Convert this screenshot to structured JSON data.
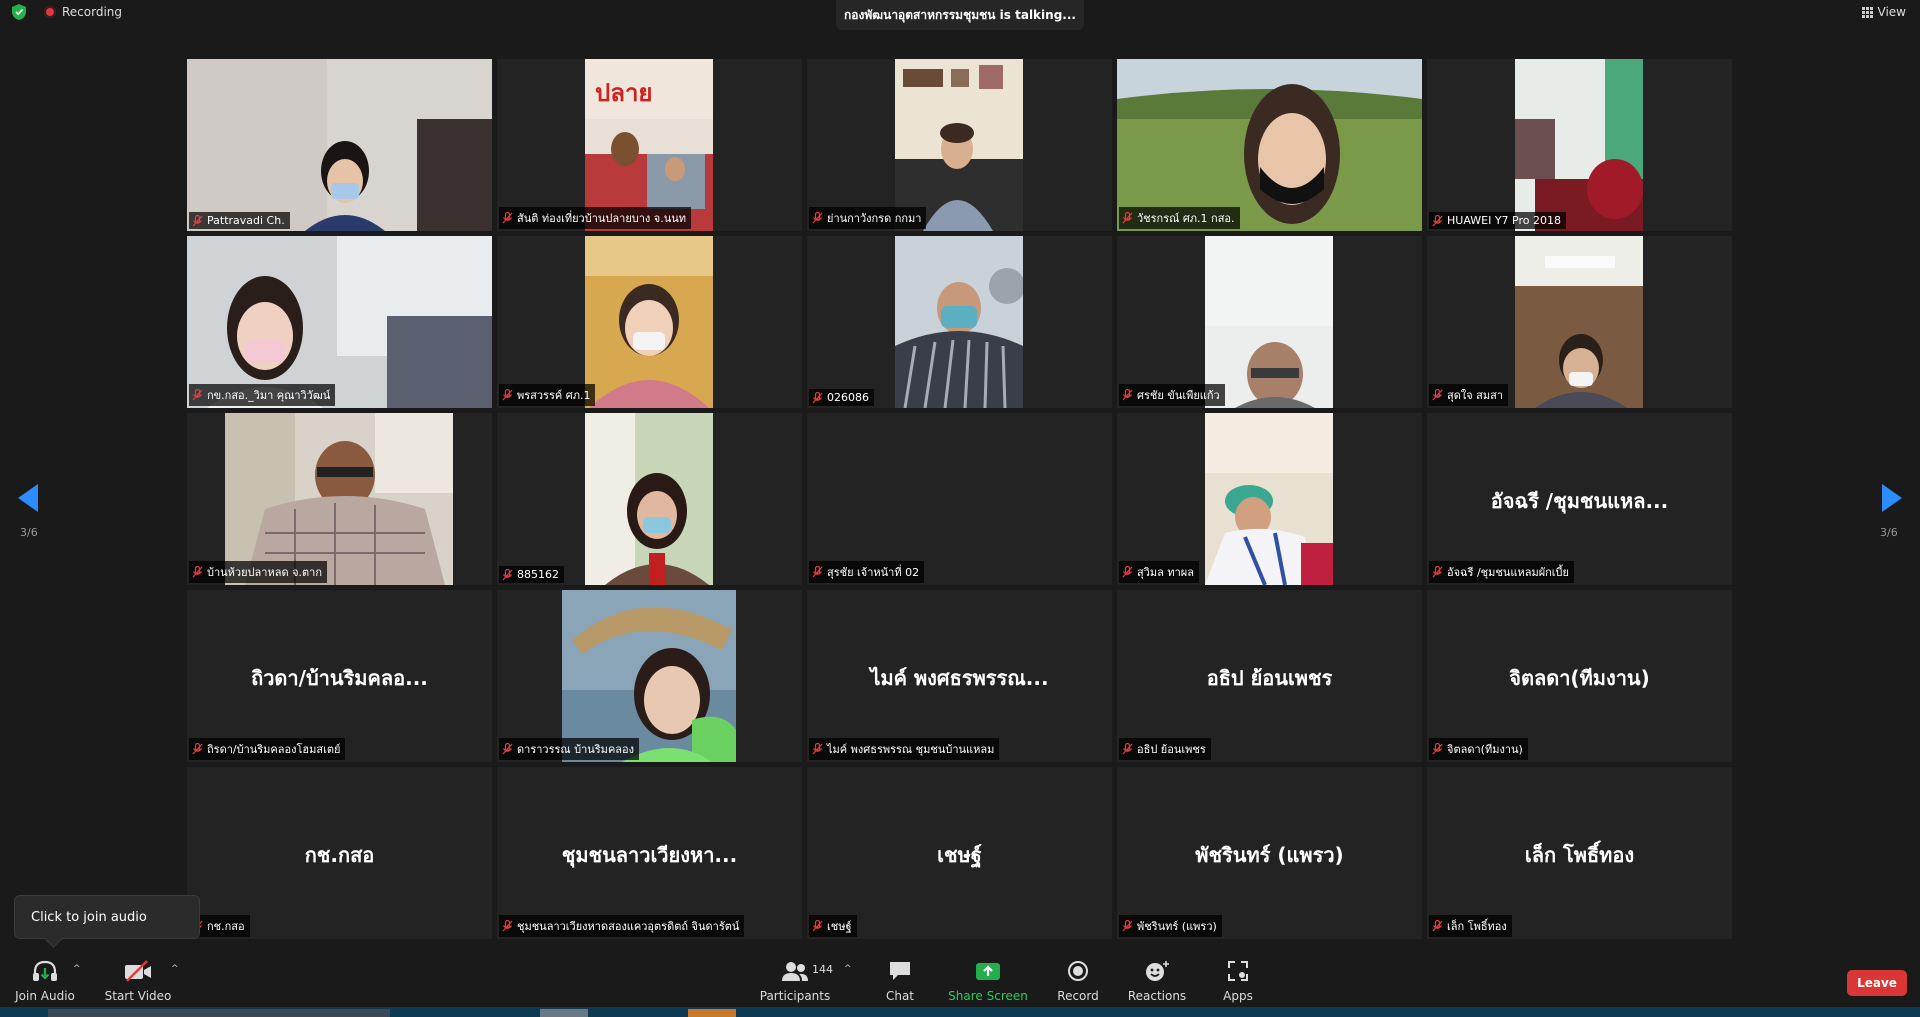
{
  "top": {
    "recording_label": "Recording",
    "talking": "กองพัฒนาอุตสาหกรรมชุมชน is talking...",
    "view_label": "View"
  },
  "pagination": {
    "left": "3/6",
    "right": "3/6"
  },
  "tiles": [
    {
      "label": "Pattravadi Ch.",
      "big": ""
    },
    {
      "label": "สันติ ท่องเที่ยวบ้านปลายบาง จ.นนท",
      "big": ""
    },
    {
      "label": "ย่านกาวังกรด กกมา",
      "big": ""
    },
    {
      "label": "วัชรกรณ์ ศภ.1 กสอ.",
      "big": ""
    },
    {
      "label": "HUAWEI Y7 Pro 2018",
      "big": ""
    },
    {
      "label": "กข.กสอ._วิมา คุณาวิวัฒน์",
      "big": ""
    },
    {
      "label": "พรสวรรค์ ศภ.1",
      "big": ""
    },
    {
      "label": "026086",
      "big": ""
    },
    {
      "label": "ศรชัย ขันเพียแก้ว",
      "big": ""
    },
    {
      "label": "สุดใจ สมสา",
      "big": ""
    },
    {
      "label": "บ้านห้วยปลาหลด จ.ตาก",
      "big": ""
    },
    {
      "label": "885162",
      "big": ""
    },
    {
      "label": "สุรชัย เจ้าหน้าที่ 02",
      "big": ""
    },
    {
      "label": "สุวิมล ทาผล",
      "big": ""
    },
    {
      "label": "อัจฉรี /ชุมชนแหลมผักเบี้ย",
      "big": "อัจฉรี /ชุมชนแหล..."
    },
    {
      "label": "ถิรดา/บ้านริมคลองโฮมสเตย์",
      "big": "ถิวดา/บ้านริมคลอ..."
    },
    {
      "label": "ดาราวรรณ บ้านริมคลอง",
      "big": ""
    },
    {
      "label": "ไมค์ พงศธรพรรณ ชุมชนบ้านแหลม",
      "big": "ไมค์ พงศธรพรรณ..."
    },
    {
      "label": "อธิป ย้อนเพชร",
      "big": "อธิป ย้อนเพชร"
    },
    {
      "label": "จิตลดา(ทีมงาน)",
      "big": "จิตลดา(ทีมงาน)"
    },
    {
      "label": "กช.กสอ",
      "big": "กช.กสอ"
    },
    {
      "label": "ชุมชนลาวเวียงหาดสองแควอุตรดิตถ์ จินดารัตน์",
      "big": "ชุมชนลาวเวียงหา..."
    },
    {
      "label": "เชษฐ์",
      "big": "เชษฐ์"
    },
    {
      "label": "พัชรินทร์ (แพรว)",
      "big": "พัชรินทร์ (แพรว)"
    },
    {
      "label": "เล็ก โพธิ์ทอง",
      "big": "เล็ก โพธิ์ทอง"
    }
  ],
  "tooltip": "Click to join audio",
  "toolbar": {
    "join_audio": "Join Audio",
    "start_video": "Start Video",
    "participants": "Participants",
    "participant_count": "144",
    "chat": "Chat",
    "share_screen": "Share Screen",
    "record": "Record",
    "reactions": "Reactions",
    "apps": "Apps",
    "leave": "Leave"
  },
  "colors": {
    "background": "#1a1a1a",
    "tile": "#232323",
    "share_green": "#23b04b",
    "leave_red": "#d93636",
    "arrow_blue": "#2d8cff"
  }
}
